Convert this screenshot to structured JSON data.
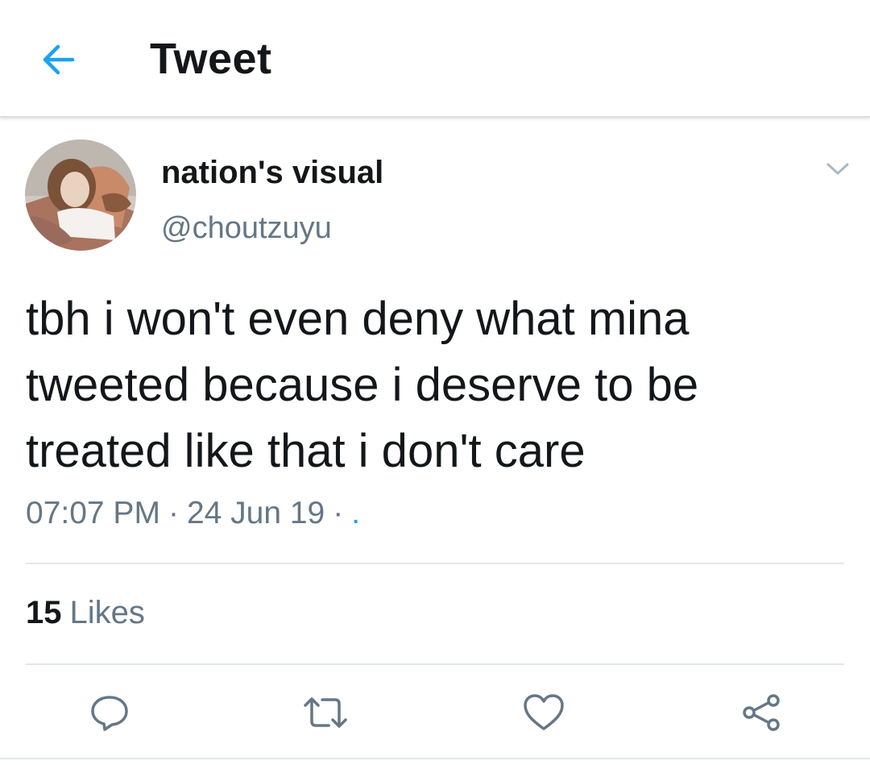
{
  "header": {
    "title": "Tweet",
    "back_icon": "arrow-left-icon",
    "accent_color": "#1da1f2"
  },
  "tweet": {
    "author": {
      "display_name": "nation's visual",
      "handle": "@choutzuyu",
      "avatar": "profile-photo"
    },
    "text": "tbh i won't even deny what mina tweeted because i deserve to be treated like that i don't care",
    "time": "07:07 PM",
    "date": "24 Jun 19",
    "source": ".",
    "separator": "·",
    "likes_count": "15",
    "likes_label": "Likes"
  },
  "actions": [
    {
      "name": "reply",
      "icon": "reply-icon"
    },
    {
      "name": "retweet",
      "icon": "retweet-icon"
    },
    {
      "name": "like",
      "icon": "heart-icon"
    },
    {
      "name": "share",
      "icon": "share-icon"
    }
  ],
  "colors": {
    "text_primary": "#14171a",
    "text_secondary": "#657786",
    "divider": "#e1e8ed"
  }
}
